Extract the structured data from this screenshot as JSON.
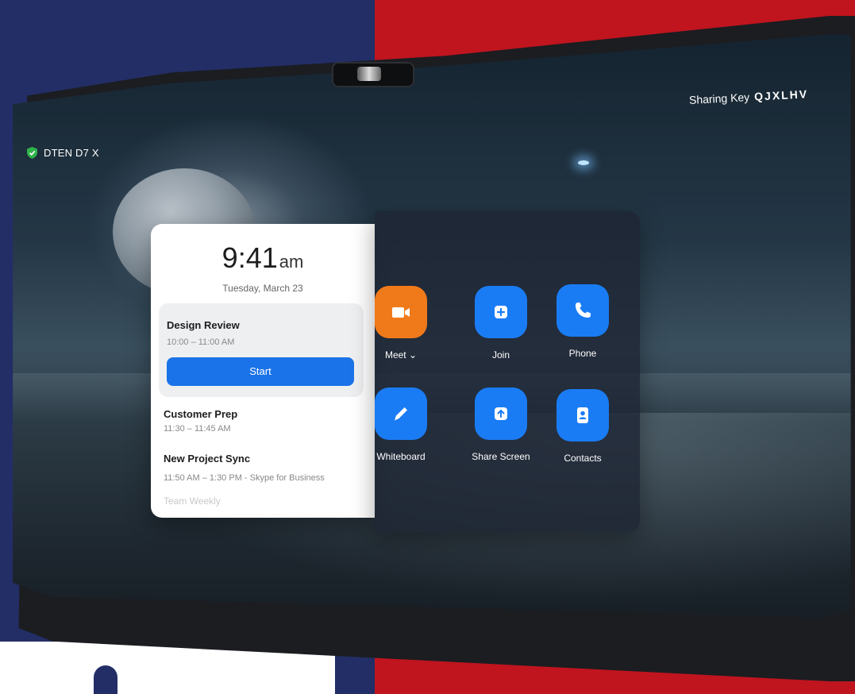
{
  "device": {
    "name": "DTEN D7 X"
  },
  "sharing": {
    "label": "Sharing Key",
    "key": "QJXLHV"
  },
  "clock": {
    "time": "9:41",
    "ampm": "am",
    "date": "Tuesday, March 23"
  },
  "events": [
    {
      "title": "Design Review",
      "time": "10:00 – 11:00 AM",
      "button": "Start"
    },
    {
      "title": "Customer Prep",
      "time": "11:30 – 11:45 AM"
    },
    {
      "title": "New Project Sync",
      "time": "11:50 AM – 1:30 PM - Skype for Business"
    },
    {
      "title": "Team Weekly"
    }
  ],
  "actions": [
    {
      "label": "Meet",
      "icon": "video-camera-icon",
      "dropdown": "⌄",
      "color": "#f07a1a"
    },
    {
      "label": "Join",
      "icon": "plus-icon",
      "color": "#1a7cf5"
    },
    {
      "label": "Phone",
      "icon": "phone-icon",
      "color": "#1a7cf5"
    },
    {
      "label": "Whiteboard",
      "icon": "pencil-icon",
      "color": "#1a7cf5"
    },
    {
      "label": "Share Screen",
      "icon": "share-up-arrow-icon",
      "color": "#1a7cf5"
    },
    {
      "label": "Contacts",
      "icon": "contact-card-icon",
      "color": "#1a7cf5"
    }
  ],
  "colors": {
    "navy": "#232e67",
    "red": "#c0141e",
    "accent_blue": "#1a73e8",
    "accent_orange": "#f07a1a"
  }
}
